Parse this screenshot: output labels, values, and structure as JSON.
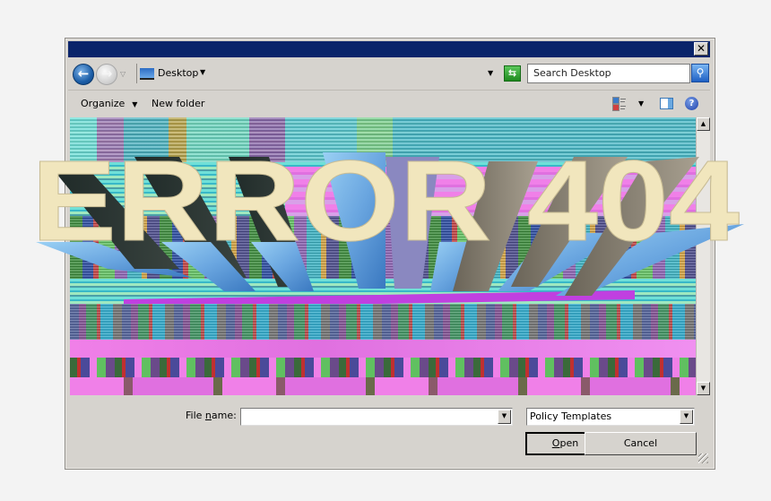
{
  "window": {
    "close_label": "✕"
  },
  "navbar": {
    "back_icon": "←",
    "forward_icon": "→",
    "history_dropdown_icon": "▽",
    "address": "Desktop",
    "address_caret": "▼",
    "address_dropdown": "▼",
    "refresh_icon": "⇆",
    "search_placeholder": "Search Desktop",
    "search_icon": "⚲"
  },
  "toolbar": {
    "organize_label": "Organize",
    "organize_caret": "▼",
    "new_folder_label": "New folder",
    "views_caret": "▼",
    "help_icon": "?"
  },
  "content": {
    "overlay_text": "ERROR 404",
    "colors": {
      "letter_face": "#f1e6bd",
      "extrusion_light": "#6aa6e0",
      "extrusion_dark": "#1f2a28",
      "glitch_magenta": "#c040e0",
      "glitch_pink": "#f080e8",
      "glitch_cyan": "#6fe0d8"
    }
  },
  "scrollbar": {
    "up_icon": "▲",
    "down_icon": "▼"
  },
  "footer": {
    "file_name_label_prefix": "File ",
    "file_name_label_accel": "n",
    "file_name_label_suffix": "ame:",
    "file_name_value": "",
    "combo_caret": "▼",
    "filter_value": "Policy Templates",
    "open_label_accel": "O",
    "open_label_rest": "pen",
    "cancel_label": "Cancel"
  }
}
